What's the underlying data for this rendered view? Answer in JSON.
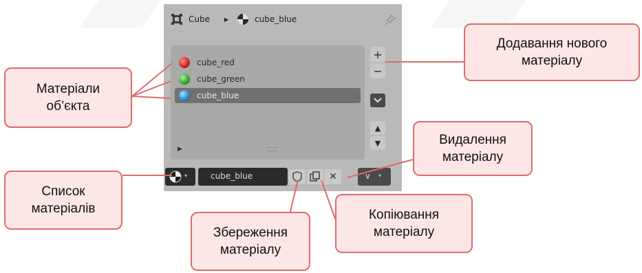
{
  "panel": {
    "header": {
      "object_name": "Cube",
      "material_name": "cube_blue",
      "object_icon": "cube-object-icon",
      "material_icon": "material-sphere-icon",
      "pin_icon": "pin-icon"
    },
    "materials": [
      {
        "label": "cube_red",
        "color": "#cc2a2a",
        "selected": false
      },
      {
        "label": "cube_green",
        "color": "#3aa83a",
        "selected": false
      },
      {
        "label": "cube_blue",
        "color": "#2f8fd0",
        "selected": true
      }
    ],
    "side_buttons": {
      "add": "+",
      "remove": "−",
      "specials": "chevron-down-icon",
      "move_up": "▲",
      "move_down": "▼"
    },
    "bottom": {
      "browse_icon": "material-sphere-icon",
      "material_field_value": "cube_blue",
      "fake_user_icon": "shield-icon",
      "duplicate_icon": "copy-icon",
      "unlink_icon": "close-icon",
      "unlink_label": "✕"
    }
  },
  "callouts": {
    "add_material": "Додавання нового\nматеріалу",
    "object_materials": "Матеріали\nоб’єкта",
    "delete_material": "Видалення\nматеріалу",
    "materials_list": "Список\nматеріалів",
    "copy_material": "Копіювання\nматеріалу",
    "save_material": "Збереження\nматеріалу"
  },
  "colors": {
    "callout_fill": "#fce6e6",
    "callout_border": "#e06a6a",
    "panel_bg": "#b9b9b9",
    "selected_row": "#707070"
  }
}
